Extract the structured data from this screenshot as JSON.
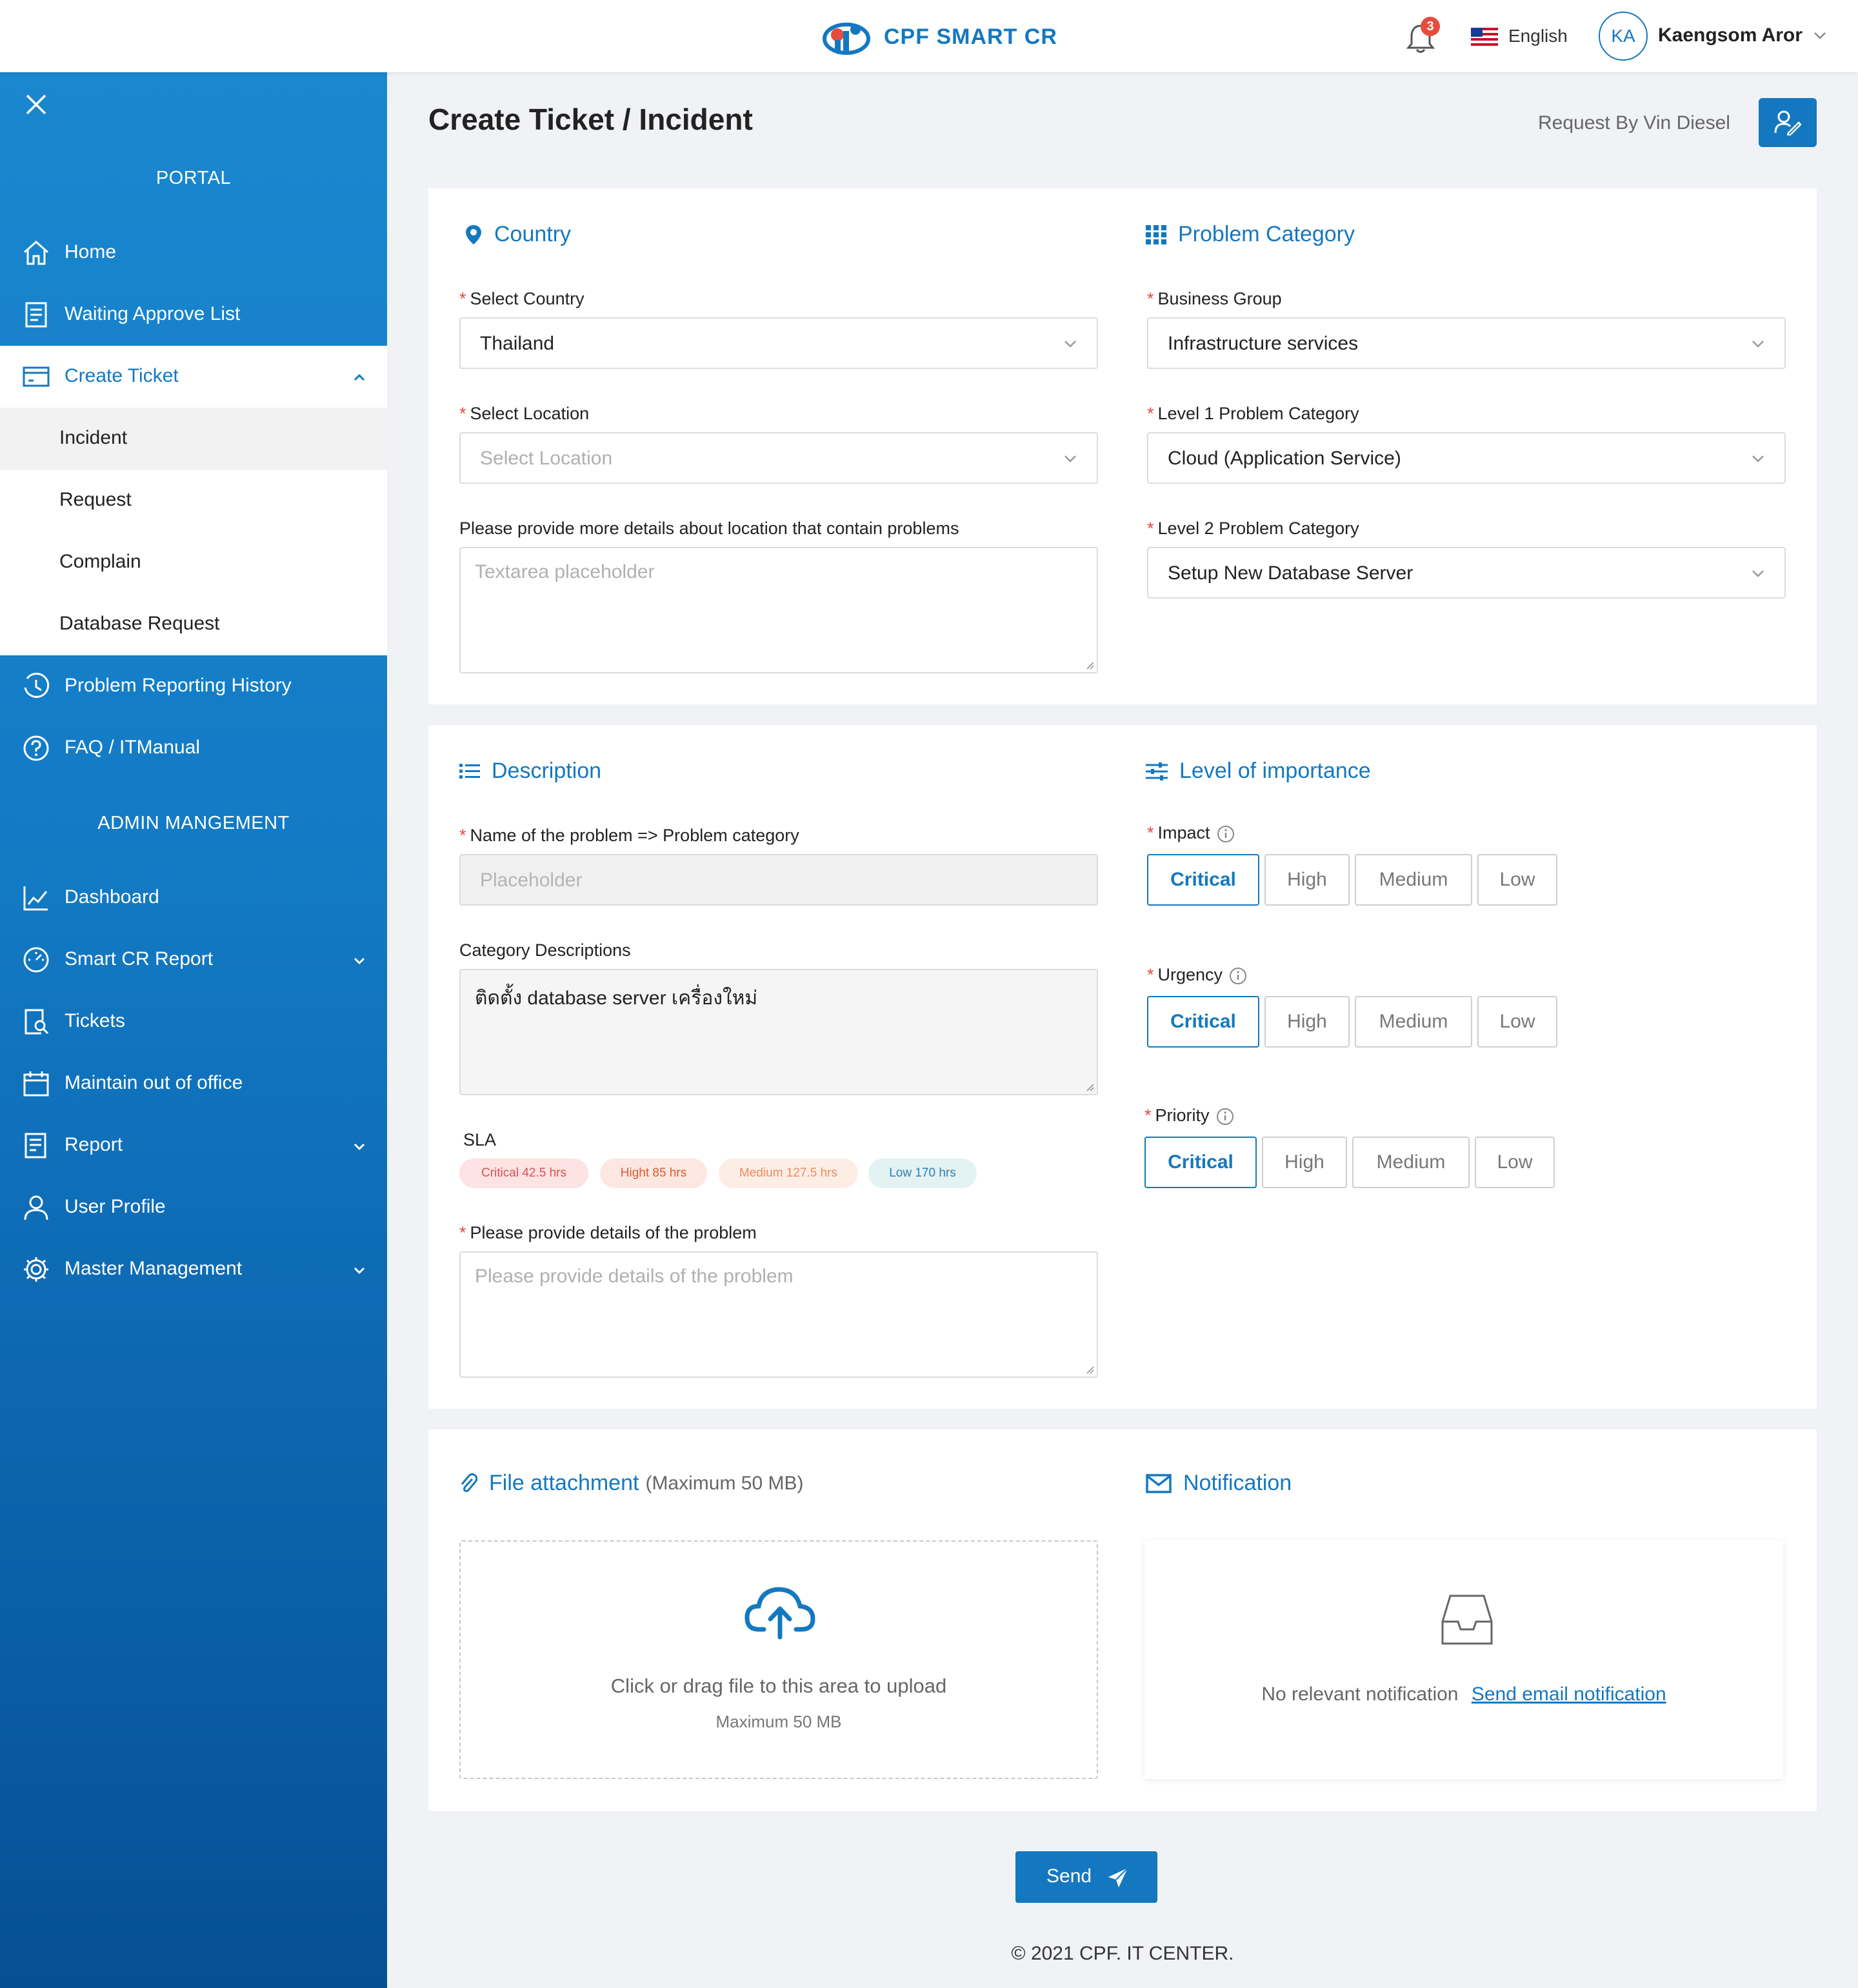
{
  "header": {
    "app_name": "CPF SMART CR",
    "notification_count": "3",
    "language": "English",
    "user_initials": "KA",
    "user_name": "Kaengsom Aror"
  },
  "sidebar": {
    "portal_title": "PORTAL",
    "admin_title": "ADMIN MANGEMENT",
    "portal_items": [
      {
        "label": "Home",
        "icon": "home-icon"
      },
      {
        "label": "Waiting Approve List",
        "icon": "document-list-icon"
      },
      {
        "label": "Create Ticket",
        "icon": "ticket-icon"
      }
    ],
    "create_ticket_sub": [
      "Incident",
      "Request",
      "Complain",
      "Database Request"
    ],
    "more_items": [
      {
        "label": "Problem Reporting History",
        "icon": "history-icon"
      },
      {
        "label": "FAQ / ITManual",
        "icon": "question-icon"
      }
    ],
    "admin_items": [
      {
        "label": "Dashboard",
        "icon": "chart-line-icon"
      },
      {
        "label": "Smart CR Report",
        "icon": "gauge-icon"
      },
      {
        "label": "Tickets",
        "icon": "ticket-search-icon"
      },
      {
        "label": "Maintain out of office",
        "icon": "calendar-icon"
      },
      {
        "label": "Report",
        "icon": "report-icon"
      },
      {
        "label": "User Profile",
        "icon": "user-icon"
      },
      {
        "label": "Master Management",
        "icon": "gear-icon"
      }
    ]
  },
  "page": {
    "title": "Create Ticket / Incident",
    "request_by": "Request By Vin Diesel"
  },
  "country": {
    "heading": "Country",
    "country_label": "Select Country",
    "country_value": "Thailand",
    "location_label": "Select Location",
    "location_placeholder": "Select Location",
    "details_label": "Please provide more details about location that contain problems",
    "details_placeholder": "Textarea placeholder"
  },
  "problem_category": {
    "heading": "Problem Category",
    "business_group_label": "Business Group",
    "business_group_value": "Infrastructure services",
    "level1_label": "Level 1 Problem Category",
    "level1_value": "Cloud (Application Service)",
    "level2_label": "Level 2 Problem Category",
    "level2_value": "Setup New Database Server"
  },
  "description": {
    "heading": "Description",
    "name_label": "Name of the problem => Problem category",
    "name_placeholder": "Placeholder",
    "category_desc_label": "Category Descriptions",
    "category_desc_value": "ติดตั้ง database server เครื่องใหม่",
    "sla_label": "SLA",
    "sla": [
      {
        "label": "Critical 42.5 hrs",
        "color": "#d9534f",
        "bg": "#fde3e3"
      },
      {
        "label": "Hight 85 hrs",
        "color": "#e4572e",
        "bg": "#fde8e1"
      },
      {
        "label": "Medium 127.5 hrs",
        "color": "#f08a5d",
        "bg": "#fdeee5"
      },
      {
        "label": "Low 170 hrs",
        "color": "#2a7fb8",
        "bg": "#e3f2f2"
      }
    ],
    "details_label": "Please provide details of the problem",
    "details_placeholder": "Please provide details of the problem"
  },
  "importance": {
    "heading": "Level of importance",
    "impact_label": "Impact",
    "urgency_label": "Urgency",
    "priority_label": "Priority",
    "options": [
      "Critical",
      "High",
      "Medium",
      "Low"
    ],
    "selected": "Critical"
  },
  "attachment": {
    "heading": "File attachment",
    "heading_note": "(Maximum 50 MB)",
    "drop_text": "Click or drag file to this area to upload",
    "drop_hint": "Maximum 50 MB"
  },
  "notification": {
    "heading": "Notification",
    "empty_text": "No relevant notification",
    "link_text": "Send email notification"
  },
  "actions": {
    "send_label": "Send"
  },
  "footer": {
    "copyright": "© 2021 CPF. IT CENTER."
  },
  "colors": {
    "accent": "#1478c0",
    "sidebar_top": "#1a87cf",
    "sidebar_bottom": "#064f93",
    "required": "#e74c3c"
  }
}
